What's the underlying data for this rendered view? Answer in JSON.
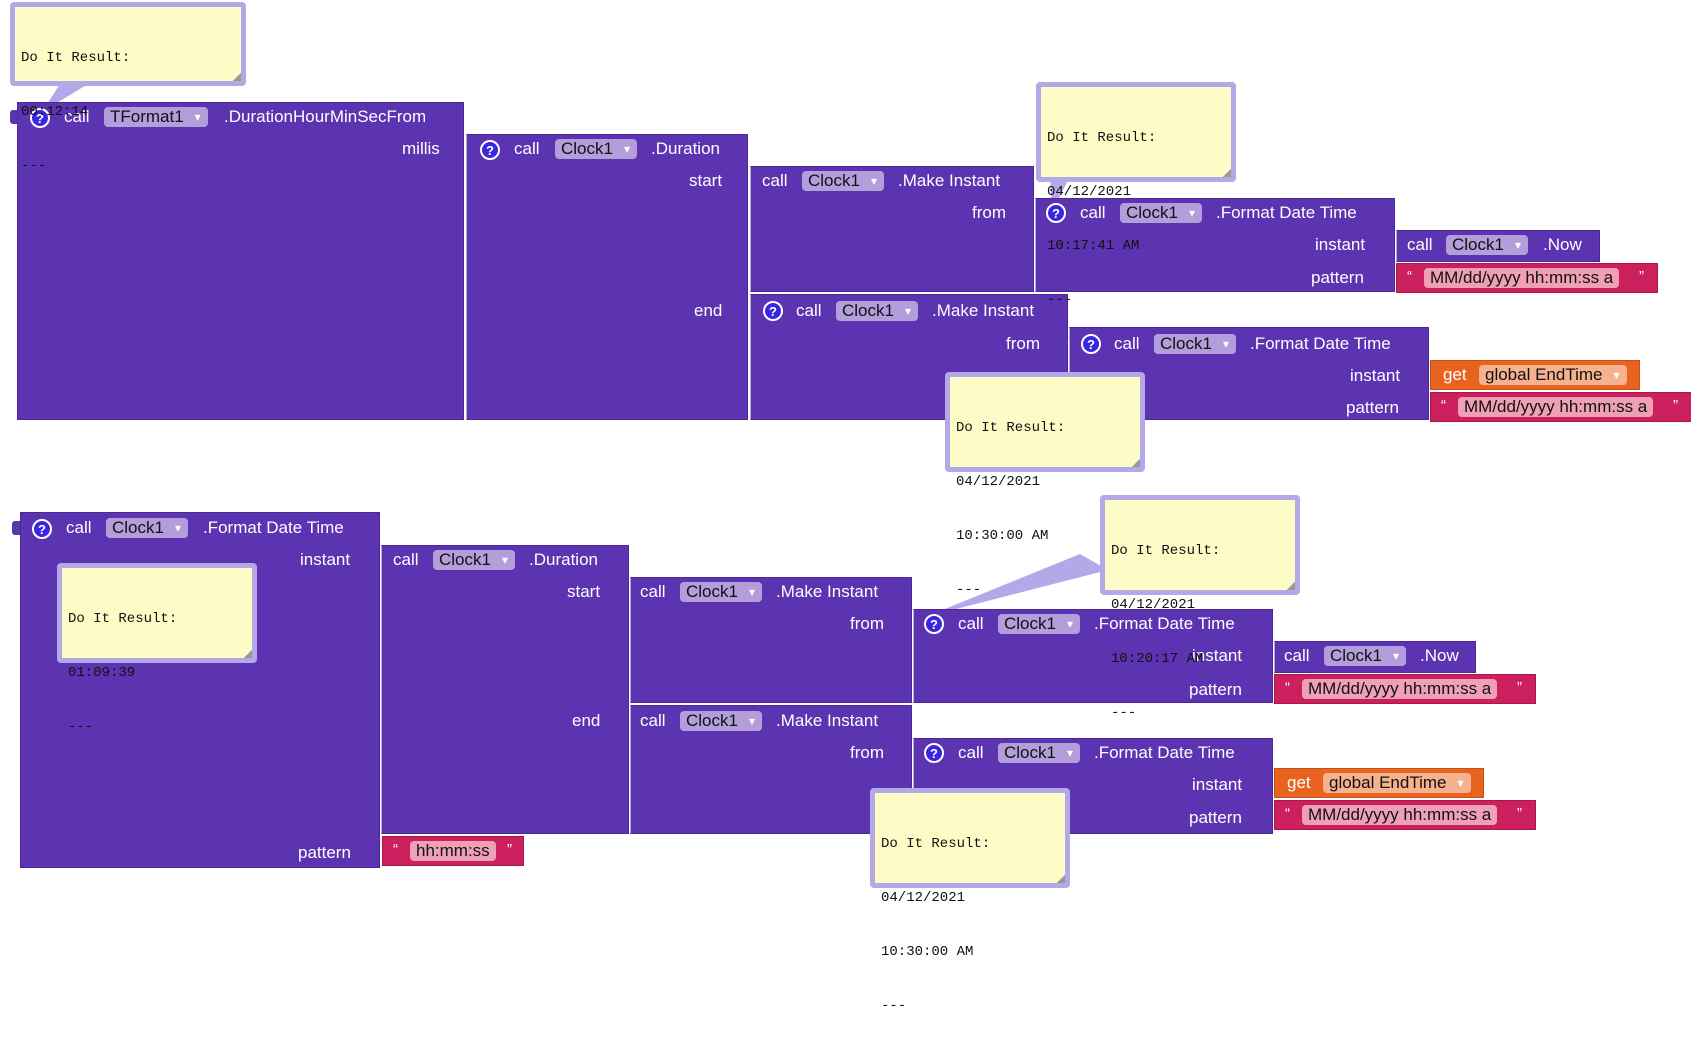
{
  "labels": {
    "call": "call",
    "millis": "millis",
    "start": "start",
    "end": "end",
    "from": "from",
    "instant": "instant",
    "pattern": "pattern",
    "get": "get",
    "help": "?",
    "open_quote": "“",
    "close_quote": "”"
  },
  "components": {
    "tformat": "TFormat1",
    "clock": "Clock1"
  },
  "methods": {
    "duration_hms": ".DurationHourMinSecFrom",
    "duration": ".Duration",
    "make_instant": ".Make Instant",
    "format_date_time": ".Format Date Time",
    "now": ".Now"
  },
  "values": {
    "pattern_full": "MM/dd/yyyy hh:mm:ss a",
    "pattern_hms": "hh:mm:ss",
    "global_var": "global EndTime"
  },
  "results": {
    "r1": [
      "Do It Result:",
      "00:12:14",
      "---"
    ],
    "r2": [
      "Do It Result:",
      "04/12/2021",
      "10:17:41 AM",
      "---"
    ],
    "r3": [
      "Do It Result:",
      "04/12/2021",
      "10:30:00 AM",
      "---"
    ],
    "r4": [
      "Do It Result:",
      "01:09:39",
      "---"
    ],
    "r5": [
      "Do It Result:",
      "04/12/2021",
      "10:20:17 AM",
      "---"
    ],
    "r6": [
      "Do It Result:",
      "04/12/2021",
      "10:30:00 AM",
      "---"
    ]
  },
  "colors": {
    "procedure_block": "#5c33b0",
    "text_block": "#cc1f5e",
    "variable_block": "#e8631e",
    "comment_bubble": "#fdfcc6"
  }
}
